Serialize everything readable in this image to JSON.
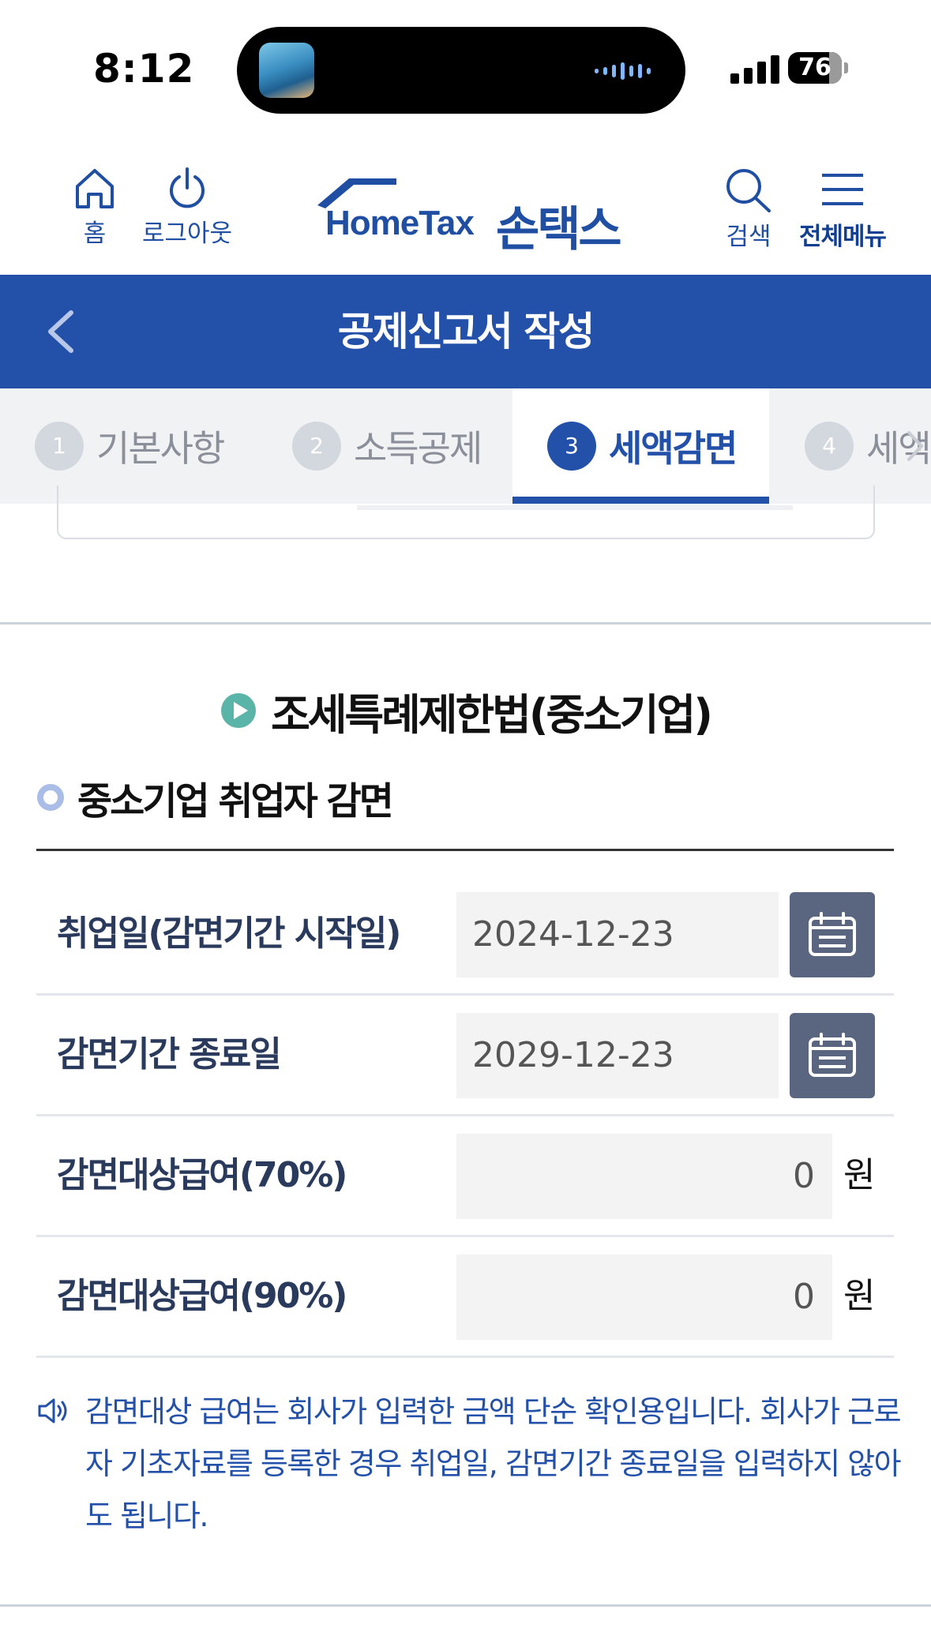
{
  "status_bar": {
    "time": "8:12",
    "battery": "76",
    "now_playing_icon": "music-album-art-icon",
    "waveform_icon": "audio-waveform-icon"
  },
  "header": {
    "home_label": "홈",
    "logout_label": "로그아웃",
    "logo_en": "HomeTax",
    "logo_ko": "손택스",
    "search_label": "검색",
    "menu_label": "전체메뉴"
  },
  "title_bar": {
    "title": "공제신고서 작성"
  },
  "steps": [
    {
      "num": "1",
      "label": "기본사항"
    },
    {
      "num": "2",
      "label": "소득공제"
    },
    {
      "num": "3",
      "label": "세액감면"
    },
    {
      "num": "4",
      "label": "세액공제"
    }
  ],
  "active_step": "3",
  "section": {
    "title": "조세특례제한법(중소기업)",
    "subtitle": "중소기업 취업자 감면"
  },
  "form": {
    "start_date_label": "취업일(감면기간 시작일)",
    "start_date_value": "2024-12-23",
    "end_date_label": "감면기간 종료일",
    "end_date_value": "2029-12-23",
    "pay70_label": "감면대상급여(70%)",
    "pay70_value": "0",
    "pay90_label": "감면대상급여(90%)",
    "pay90_value": "0",
    "unit": "원"
  },
  "notice": {
    "text": "감면대상 급여는 회사가 입력한 금액 단순 확인용입니다. 회사가 근로자 기초자료를 등록한 경우 취업일, 감면기간 종료일을 입력하지 않아도 됩니다."
  },
  "colors": {
    "brand_blue": "#2350a8",
    "calendar_button": "#5a6680",
    "play_icon": "#5ab5a8"
  }
}
